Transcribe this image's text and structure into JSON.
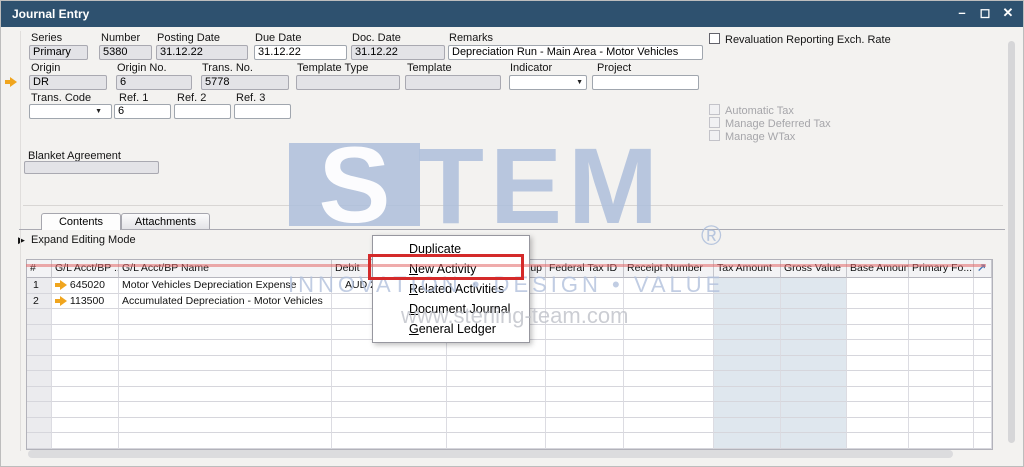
{
  "window": {
    "title": "Journal Entry"
  },
  "icons": {
    "minimize": "–",
    "maximize": "◻",
    "close": "✕",
    "dropdown": "▼",
    "expand_mode": "▶",
    "expand_grid": "↗"
  },
  "fields": {
    "series": {
      "label": "Series",
      "value": "Primary"
    },
    "number": {
      "label": "Number",
      "value": "5380"
    },
    "posting_date": {
      "label": "Posting Date",
      "value": "31.12.22"
    },
    "due_date": {
      "label": "Due Date",
      "value": "31.12.22"
    },
    "doc_date": {
      "label": "Doc. Date",
      "value": "31.12.22"
    },
    "remarks": {
      "label": "Remarks",
      "value": "Depreciation Run - Main Area - Motor Vehicles"
    },
    "origin": {
      "label": "Origin",
      "value": "DR"
    },
    "origin_no": {
      "label": "Origin No.",
      "value": "6"
    },
    "trans_no": {
      "label": "Trans. No.",
      "value": "5778"
    },
    "template_type": {
      "label": "Template Type",
      "value": ""
    },
    "template": {
      "label": "Template",
      "value": ""
    },
    "indicator": {
      "label": "Indicator",
      "value": ""
    },
    "project": {
      "label": "Project",
      "value": ""
    },
    "trans_code": {
      "label": "Trans. Code",
      "value": ""
    },
    "ref1": {
      "label": "Ref. 1",
      "value": "6"
    },
    "ref2": {
      "label": "Ref. 2",
      "value": ""
    },
    "ref3": {
      "label": "Ref. 3",
      "value": ""
    },
    "blanket_agreement": {
      "label": "Blanket Agreement",
      "value": ""
    }
  },
  "checkboxes": {
    "revaluation": "Revaluation Reporting Exch. Rate",
    "automatic_tax": "Automatic Tax",
    "manage_deferred_tax": "Manage Deferred Tax",
    "manage_wtax": "Manage WTax"
  },
  "tabs": {
    "contents": "Contents",
    "attachments": "Attachments"
  },
  "editing": {
    "expand_label": "Expand Editing Mode"
  },
  "table": {
    "columns": [
      "#",
      "G/L Acct/BP ...",
      "G/L Acct/BP Name",
      "Debit",
      "up",
      "Federal Tax ID",
      "Receipt Number",
      "Tax Amount",
      "Gross Value",
      "Base Amount",
      "Primary Fo...",
      ""
    ],
    "rows": [
      {
        "num": "1",
        "acct": "645020",
        "name": "Motor Vehicles Depreciation Expense",
        "debit": "AUD 2"
      },
      {
        "num": "2",
        "acct": "113500",
        "name": "Accumulated Depreciation - Motor Vehicles",
        "debit": ""
      }
    ],
    "empty_row_count": 9
  },
  "context_menu": {
    "items": [
      "Duplicate",
      "New Activity",
      "Related Activities",
      "Document Journal",
      "General Ledger"
    ],
    "highlighted": "New Activity"
  },
  "watermark": {
    "logo_first": "S",
    "logo_rest": "TEM",
    "registered": "®",
    "tagline": "INNOVATION • DESIGN • VALUE",
    "url": "www.sterling-team.com"
  },
  "colors": {
    "titlebar": "#2e516f",
    "annotation_red": "#d42a2a",
    "watermark_blue": "#adbddb",
    "link_arrow_orange": "#f0a51e"
  }
}
